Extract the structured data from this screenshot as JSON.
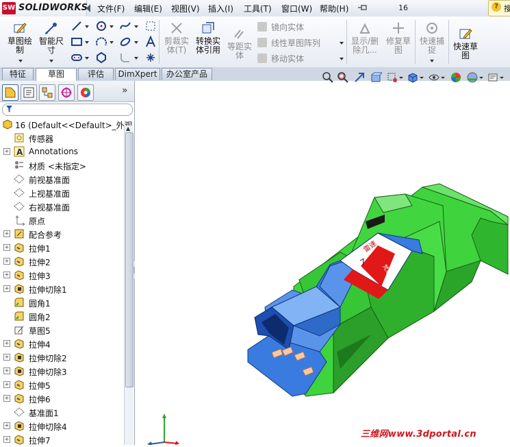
{
  "app": {
    "brand": "SOLIDWORKS",
    "brand_badge": "SW",
    "document": "16"
  },
  "menu": [
    "文件(F)",
    "编辑(E)",
    "视图(V)",
    "插入(I)",
    "工具(T)",
    "窗口(W)",
    "帮助(H)"
  ],
  "help": {
    "label": "搜"
  },
  "commands": {
    "sketch": "草图绘制",
    "smart_dim": "智能尺寸",
    "trim": "剪裁实体(T)",
    "convert": "转换实体引用",
    "offset": "等距实体",
    "mirror": "镜向实体",
    "linear_pattern": "线性草图阵列",
    "move": "移动实体",
    "show_delete": "显示/删除几...",
    "repair": "修复草图",
    "quick_snap": "快速捕捉",
    "rapid_sketch": "快速草图"
  },
  "tabs": [
    "特征",
    "草图",
    "评估",
    "DimXpert",
    "办公室产品"
  ],
  "active_tab": 1,
  "tree": {
    "root": "16  (Default<<Default>_外观",
    "items": [
      {
        "label": "传感器",
        "icon": "sensor-icon",
        "expand": false
      },
      {
        "label": "Annotations",
        "icon": "annotations-icon",
        "expand": true
      },
      {
        "label": "材质 <未指定>",
        "icon": "material-icon",
        "expand": false
      },
      {
        "label": "前视基准面",
        "icon": "plane-icon",
        "expand": false
      },
      {
        "label": "上视基准面",
        "icon": "plane-icon",
        "expand": false
      },
      {
        "label": "右视基准面",
        "icon": "plane-icon",
        "expand": false
      },
      {
        "label": "原点",
        "icon": "origin-icon",
        "expand": false
      },
      {
        "label": "配合参考",
        "icon": "mate-reference-icon",
        "expand": true
      },
      {
        "label": "拉伸1",
        "icon": "extrude-icon",
        "expand": true
      },
      {
        "label": "拉伸2",
        "icon": "extrude-icon",
        "expand": true
      },
      {
        "label": "拉伸3",
        "icon": "extrude-icon",
        "expand": true
      },
      {
        "label": "拉伸切除1",
        "icon": "cut-extrude-icon",
        "expand": true
      },
      {
        "label": "圆角1",
        "icon": "fillet-icon",
        "expand": false
      },
      {
        "label": "圆角2",
        "icon": "fillet-icon",
        "expand": false
      },
      {
        "label": "草图5",
        "icon": "sketch-icon",
        "expand": false
      },
      {
        "label": "拉伸4",
        "icon": "extrude-icon",
        "expand": true
      },
      {
        "label": "拉伸切除2",
        "icon": "cut-extrude-icon",
        "expand": true
      },
      {
        "label": "拉伸切除3",
        "icon": "cut-extrude-icon",
        "expand": true
      },
      {
        "label": "拉伸5",
        "icon": "extrude-icon",
        "expand": true
      },
      {
        "label": "拉伸6",
        "icon": "extrude-icon",
        "expand": true
      },
      {
        "label": "基准面1",
        "icon": "plane-icon",
        "expand": false
      },
      {
        "label": "拉伸切除4",
        "icon": "cut-extrude-icon",
        "expand": true
      },
      {
        "label": "拉伸7",
        "icon": "extrude-icon",
        "expand": true
      }
    ]
  },
  "model_decal": {
    "text_top": "雷速",
    "text_mid": "7",
    "text_side": "梵恩"
  },
  "watermark": "三维网www.3dportal.cn",
  "colors": {
    "green": "#3fd43d",
    "blue": "#3a7be0",
    "decal_red": "#e01818",
    "brand_red": "#c8102e"
  }
}
